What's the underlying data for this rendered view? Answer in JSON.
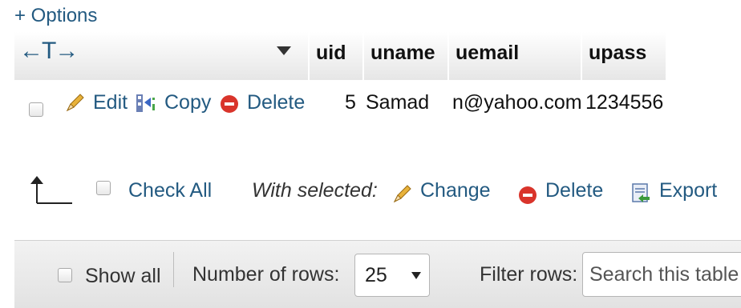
{
  "options_toggle": "+ Options",
  "header": {
    "resize_arrows": "←T→",
    "columns": [
      "uid",
      "uname",
      "uemail",
      "upass"
    ]
  },
  "row": {
    "edit": "Edit",
    "copy": "Copy",
    "delete": "Delete",
    "uid": "5",
    "uname": "Samad",
    "uemail": "n@yahoo.com",
    "upass": "1234556"
  },
  "bulk": {
    "check_all": "Check All",
    "with_selected": "With selected:",
    "change": "Change",
    "delete": "Delete",
    "export": "Export"
  },
  "footer": {
    "show_all": "Show all",
    "rows_label": "Number of rows:",
    "rows_value": "25",
    "filter_label": "Filter rows:",
    "search_placeholder": "Search this table"
  },
  "colors": {
    "link": "#235a81",
    "delete_icon": "#d9342b",
    "pencil": "#e8b23a"
  }
}
